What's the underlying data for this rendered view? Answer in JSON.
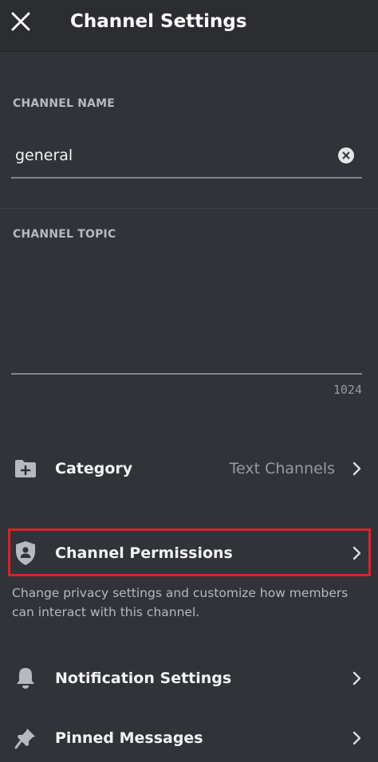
{
  "header": {
    "title": "Channel Settings",
    "close_icon": "close-icon"
  },
  "channel_name": {
    "label": "CHANNEL NAME",
    "value": "general",
    "clear_icon": "clear-input-icon"
  },
  "channel_topic": {
    "label": "CHANNEL TOPIC",
    "value": "",
    "remaining_chars": "1024"
  },
  "rows": {
    "category": {
      "icon": "folder-plus-icon",
      "label": "Category",
      "value": "Text Channels"
    },
    "permissions": {
      "icon": "shield-user-icon",
      "label": "Channel Permissions",
      "description": "Change privacy settings and customize how members can interact with this channel.",
      "highlight_color": "#d9222a"
    },
    "notifications": {
      "icon": "bell-icon",
      "label": "Notification Settings"
    },
    "pinned": {
      "icon": "pin-icon",
      "label": "Pinned Messages"
    }
  },
  "colors": {
    "background": "#313338",
    "header_background": "#2b2d31",
    "text_primary": "#f2f3f5",
    "text_muted": "#b5bac1"
  }
}
